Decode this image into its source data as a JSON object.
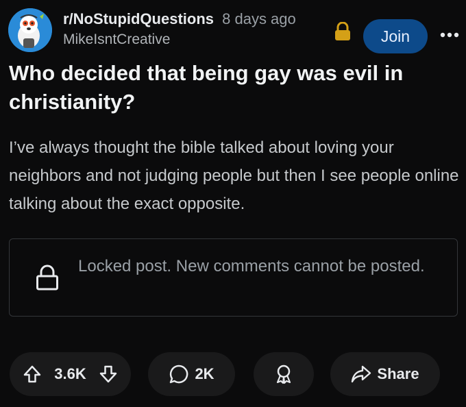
{
  "post": {
    "subreddit": "r/NoStupidQuestions",
    "time_ago": "8 days ago",
    "author": "MikeIsntCreative",
    "join_label": "Join",
    "title": "Who decided that being gay was evil in christianity?",
    "body": "I’ve always thought the bible talked about loving your neighbors and not judging people but then I see people online talking about the exact opposite.",
    "locked_message": "Locked post. New comments cannot be posted."
  },
  "actions": {
    "vote_count": "3.6K",
    "comment_count": "2K",
    "share_label": "Share"
  },
  "icons": {
    "header": [
      "lock-icon",
      "more-icon"
    ],
    "locked": "lock-icon",
    "actions": [
      "upvote-icon",
      "downvote-icon",
      "comment-icon",
      "award-icon",
      "share-icon"
    ]
  },
  "colors": {
    "background": "#0b0b0c",
    "join_button": "#0d4a8a",
    "lock_badge": "#d4a017",
    "pill": "#1a1a1b"
  }
}
